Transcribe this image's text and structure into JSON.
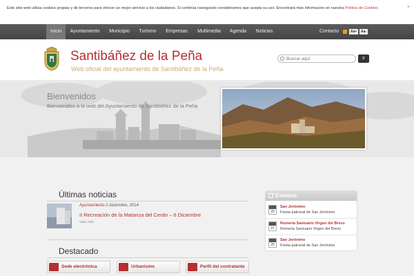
{
  "cookie": {
    "text": "Este sitio web utiliza cookies propias y de terceros para ofrecer un mejor servicio a los ciudadanos. Si continúa navegando consideramos que acepta su uso. Encontrará más información en nuestra ",
    "link": "Política de Cookies",
    "close": "×"
  },
  "nav": {
    "items": [
      "Inicio",
      "Ayuntamiento",
      "Municipio",
      "Turismo",
      "Empresas",
      "Multimedia",
      "Agenda",
      "Noticias"
    ],
    "contact": "Contacto",
    "font_up": "Aa+",
    "font_down": "Aa-"
  },
  "header": {
    "title": "Santibáñez de la Peña",
    "subtitle": "Web oficial del ayuntamiento de Santibáñez de la Peña",
    "search_placeholder": "Buscar aquí",
    "search_button": "Ir"
  },
  "banner": {
    "title": "Bienvenidos",
    "text": "Bienvenidos a la web del Ayuntamiento de Santibáñez de la Peña"
  },
  "news": {
    "title": "Últimas noticias",
    "item": {
      "category": "Ayuntamiento",
      "date": "2 diciembre, 2014",
      "headline": "II Recreación de la Matanza del Cerdo – 6 Diciembre",
      "more": "saber más"
    }
  },
  "featured": {
    "title": "Destacado",
    "buttons": [
      "Sede electrónica",
      "Urbanismo",
      "Perfil del contratante"
    ]
  },
  "events": {
    "title": "Eventos",
    "items": [
      {
        "month": "ABR",
        "day": "20",
        "name": "San Jerónimo",
        "desc": "Fiesta patronal de San Jerónimo"
      },
      {
        "month": "SEP",
        "day": "21",
        "name": "Romería Santuario Virgen del Brezo",
        "desc": "Romería Santuario Virgen del Brezo"
      },
      {
        "month": "ABR",
        "day": "20",
        "name": "San Jerónimo",
        "desc": "Fiesta patronal de San Jerónimo"
      }
    ]
  },
  "colors": {
    "accent": "#b43030",
    "nav_bg": "#4f4f4f",
    "subtitle": "#c9a978"
  }
}
